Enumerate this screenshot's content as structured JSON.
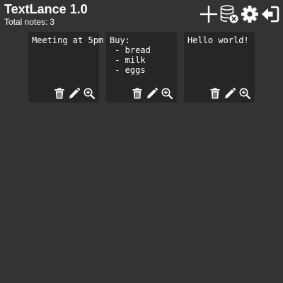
{
  "app": {
    "title": "TextLance 1.0",
    "count_label": "Total notes:",
    "count_value": "3"
  },
  "toolbar": {
    "icons": [
      "add-icon",
      "database-remove-icon",
      "settings-icon",
      "logout-icon"
    ]
  },
  "colors": {
    "background": "#333333",
    "card": "#262626",
    "text": "#ffffff"
  },
  "notes": [
    {
      "text": "Meeting at 5pm",
      "actions": [
        "trash-icon",
        "pencil-icon",
        "zoom-in-icon"
      ]
    },
    {
      "text": "Buy:\n - bread\n - milk\n - eggs",
      "actions": [
        "trash-icon",
        "pencil-icon",
        "zoom-in-icon"
      ]
    },
    {
      "text": "Hello world!",
      "actions": [
        "trash-icon",
        "pencil-icon",
        "zoom-in-icon"
      ]
    }
  ]
}
